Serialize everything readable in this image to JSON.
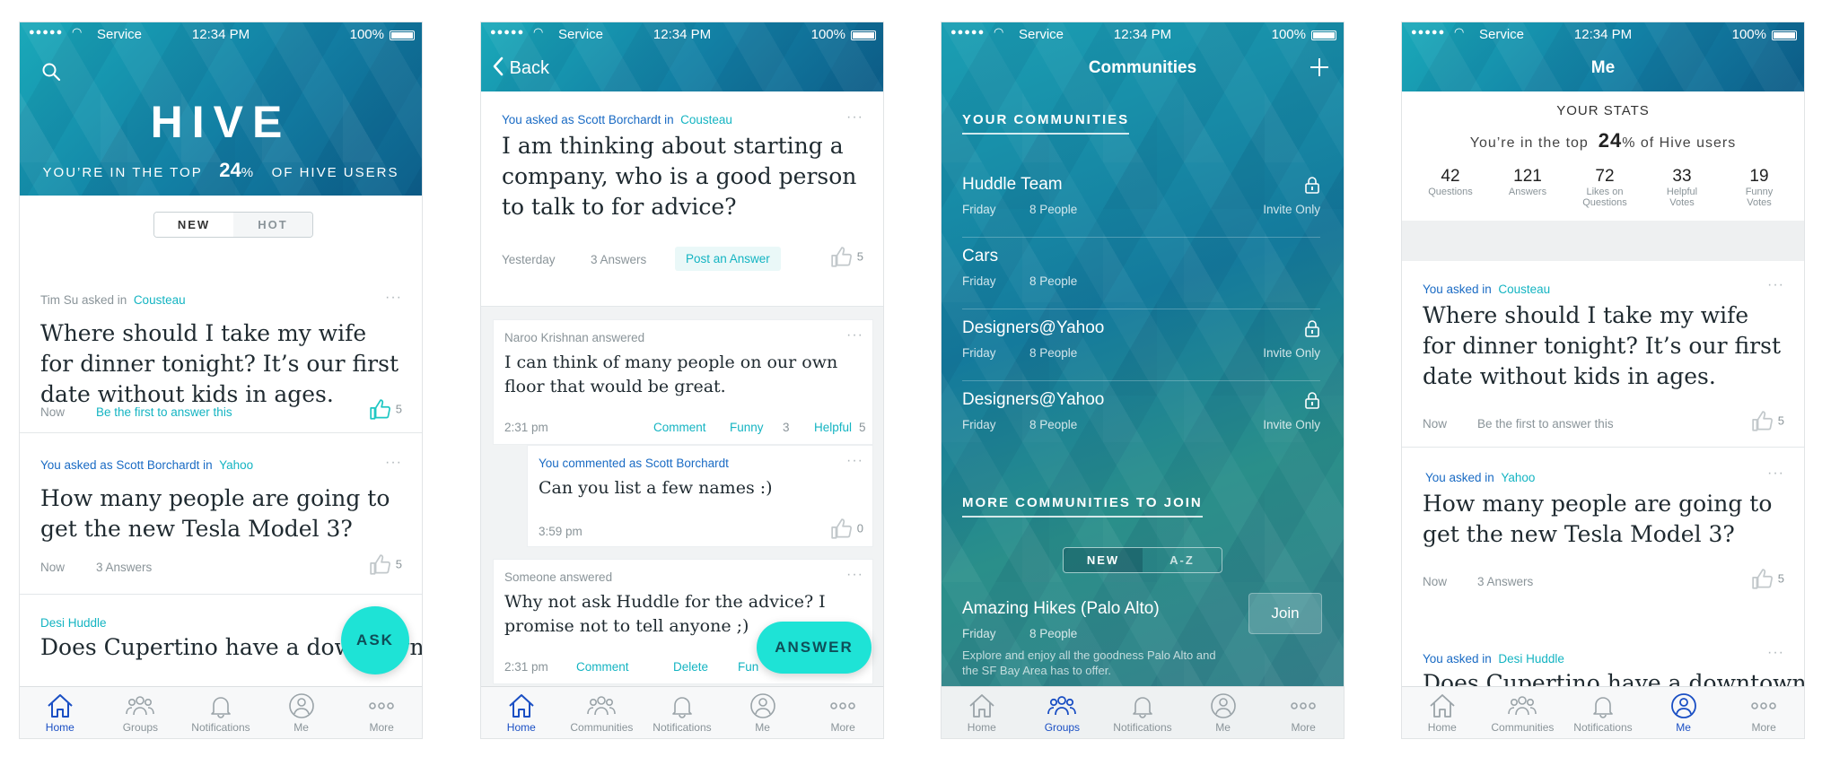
{
  "status_bar": {
    "signal": "●●●●●",
    "carrier": "Service",
    "time": "12:34 PM",
    "battery": "100%"
  },
  "screen1": {
    "logo": "HIVE",
    "top_prefix": "YOU’RE IN THE TOP",
    "top_value": "24",
    "top_pct": "%",
    "top_suffix": "OF HIVE USERS",
    "seg_new": "NEW",
    "seg_hot": "HOT",
    "cards": [
      {
        "meta_pre": "Tim Su asked in",
        "meta_comm": "Cousteau",
        "question": "Where should I take my wife for dinner tonight? It’s our first date without kids in ages.",
        "time": "Now",
        "action": "Be the first to answer this",
        "likes": "5"
      },
      {
        "meta_pre": "You asked as Scott Borchardt in",
        "meta_comm": "Yahoo",
        "question": "How many people are going to get the new Tesla Model 3?",
        "time": "Now",
        "answers": "3 Answers",
        "likes": "5"
      },
      {
        "meta_comm": "Desi Huddle",
        "question": "Does Cupertino have a downtown like other towns around here?"
      }
    ],
    "fab": "ASK",
    "tabs": [
      "Home",
      "Groups",
      "Notifications",
      "Me",
      "More"
    ]
  },
  "screen2": {
    "back": "Back",
    "meta_pre": "You asked as Scott Borchardt in",
    "meta_comm": "Cousteau",
    "question": "I am thinking about starting a company, who is a good person to talk to for advice?",
    "time": "Yesterday",
    "answers": "3 Answers",
    "post": "Post an Answer",
    "likes": "5",
    "answer1": {
      "meta": "Naroo Krishnan answered",
      "text": "I can think of many people on our own floor that would be great.",
      "time": "2:31 pm",
      "comment": "Comment",
      "funny": "Funny",
      "funny_n": "3",
      "helpful": "Helpful",
      "helpful_n": "5"
    },
    "comment1": {
      "meta": "You commented as Scott Borchardt",
      "text": "Can you list a few names :)",
      "time": "3:59 pm",
      "likes": "0"
    },
    "answer2": {
      "meta": "Someone answered",
      "text": "Why not ask Huddle for the advice? I promise not to tell anyone ;)",
      "time": "2:31 pm",
      "comment": "Comment",
      "delete": "Delete",
      "funny": "Fun"
    },
    "fab": "ANSWER",
    "tabs": [
      "Home",
      "Communities",
      "Notifications",
      "Me",
      "More"
    ]
  },
  "screen3": {
    "title": "Communities",
    "plus": "+",
    "your_h": "YOUR COMMUNITIES",
    "communities": [
      {
        "name": "Huddle Team",
        "day": "Friday",
        "people": "8 People",
        "invite": "Invite Only"
      },
      {
        "name": "Cars",
        "day": "Friday",
        "people": "8 People",
        "invite": ""
      },
      {
        "name": "Designers@Yahoo",
        "day": "Friday",
        "people": "8 People",
        "invite": "Invite Only"
      },
      {
        "name": "Designers@Yahoo",
        "day": "Friday",
        "people": "8 People",
        "invite": "Invite Only"
      }
    ],
    "more_h": "MORE COMMUNITIES TO JOIN",
    "seg_new": "NEW",
    "seg_az": "A-Z",
    "join_item": {
      "name": "Amazing Hikes (Palo Alto)",
      "day": "Friday",
      "people": "8 People",
      "desc": "Explore and enjoy all the goodness Palo Alto and the SF Bay Area has to offer.",
      "join": "Join"
    },
    "tabs": [
      "Home",
      "Groups",
      "Notifications",
      "Me",
      "More"
    ]
  },
  "screen4": {
    "title": "Me",
    "stats_title": "YOUR STATS",
    "top_prefix": "You’re in the top",
    "top_value": "24",
    "top_pct": "%",
    "top_suffix": "of Hive users",
    "stats": [
      {
        "n": "42",
        "l": "Questions"
      },
      {
        "n": "121",
        "l": "Answers"
      },
      {
        "n": "72",
        "l": "Likes on Questions"
      },
      {
        "n": "33",
        "l": "Helpful Votes"
      },
      {
        "n": "19",
        "l": "Funny Votes"
      }
    ],
    "cards": [
      {
        "meta_pre": "You asked in",
        "meta_comm": "Cousteau",
        "question": "Where should I take my wife for dinner tonight? It’s our first date without kids in ages.",
        "time": "Now",
        "action": "Be the first to answer this",
        "likes": "5"
      },
      {
        "meta_pre": "You asked in",
        "meta_comm": "Yahoo",
        "question": "How many people are going to get the new Tesla Model 3?",
        "time": "Now",
        "answers": "3 Answers",
        "likes": "5"
      },
      {
        "meta_pre": "You asked in",
        "meta_comm": "Desi Huddle",
        "question": "Does Cupertino have a downtown"
      }
    ],
    "tabs": [
      "Home",
      "Communities",
      "Notifications",
      "Me",
      "More"
    ]
  },
  "colors": {
    "teal_accent": "#14b4c2",
    "link_blue": "#1a6bc4",
    "fab": "#1ee3d6",
    "active_tab": "#1a4fc4",
    "header_teal": "#0f86a8"
  },
  "icons": [
    "search-icon",
    "thumbs-up-icon",
    "home-icon",
    "groups-icon",
    "bell-icon",
    "person-icon",
    "more-icon",
    "lock-icon",
    "chevron-left-icon",
    "plus-icon"
  ]
}
